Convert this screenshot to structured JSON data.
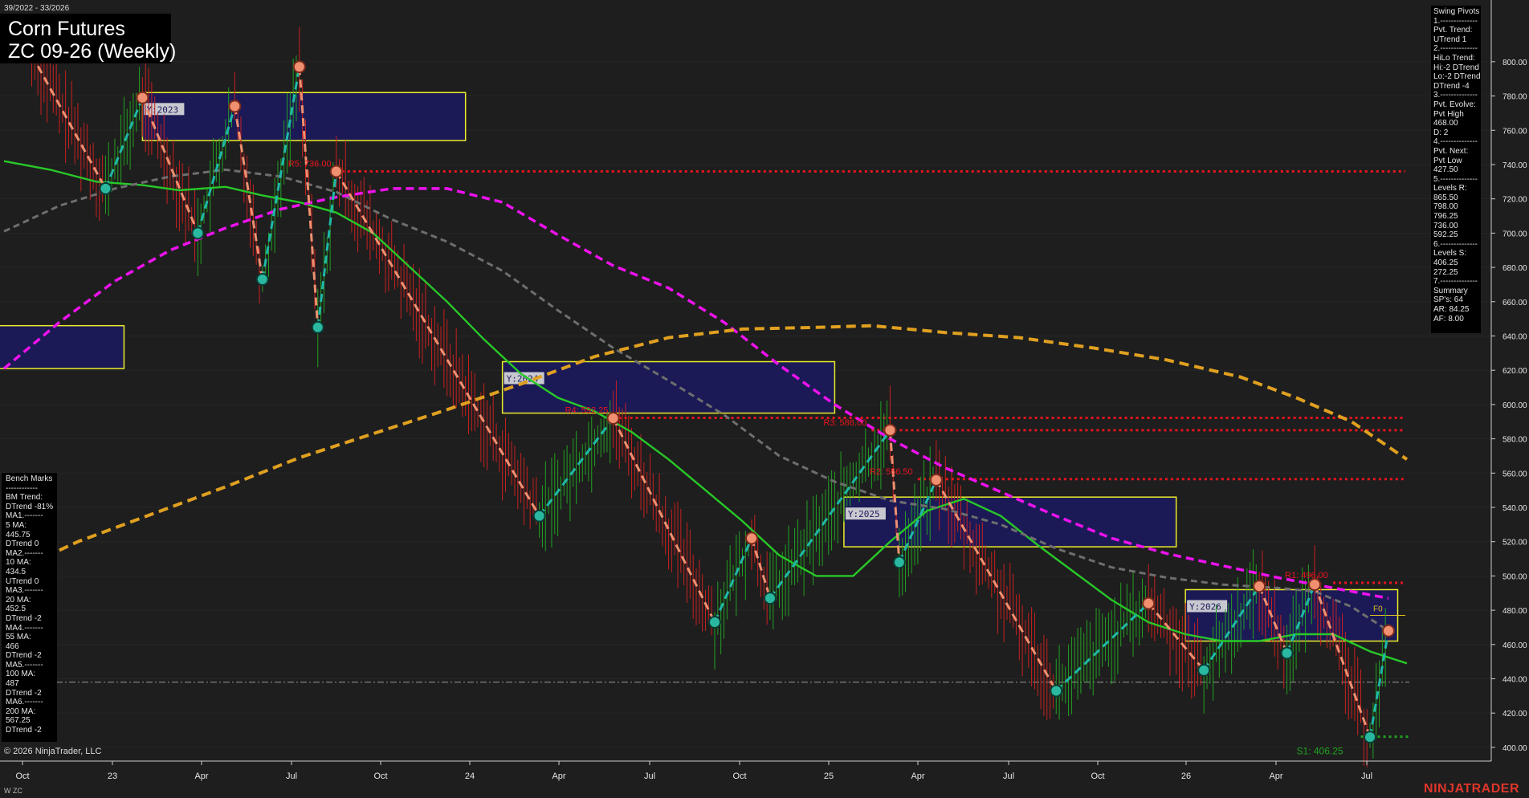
{
  "header": {
    "date_range": "39/2022 - 33/2026",
    "instrument": "Corn Futures",
    "contract": "ZC 09-26 (Weekly)",
    "copyright": "© 2026 NinjaTrader, LLC",
    "footer_tag": "W ZC",
    "brand": "NINJATRADER"
  },
  "bench_marks": {
    "lines": [
      "Bench Marks",
      "------------",
      "BM Trend:",
      "DTrend -81%",
      "MA1.-------",
      "5 MA:",
      "445.75",
      "DTrend 0",
      "MA2.-------",
      "10 MA:",
      "434.5",
      "UTrend 0",
      "MA3.-------",
      "20 MA:",
      "452.5",
      "DTrend -2",
      "MA4.-------",
      "55 MA:",
      "466",
      "DTrend -2",
      "MA5.-------",
      "100 MA:",
      "487",
      "DTrend -2",
      "MA6.-------",
      "200 MA:",
      "567.25",
      "DTrend -2"
    ]
  },
  "swing_pivots": {
    "lines": [
      "Swing Pivots",
      "1.--------------",
      "Pvt. Trend:",
      "UTrend 1",
      "2.--------------",
      "HiLo Trend:",
      "Hi:-2 DTrend",
      "Lo:-2 DTrend",
      "DTrend -4",
      "3.--------------",
      "Pvt. Evolve:",
      "Pvt High",
      "468.00",
      "D: 2",
      "4.--------------",
      "Pvt. Next:",
      "Pvt Low",
      "427.50",
      "5.--------------",
      "Levels R:",
      "865.50",
      "798.00",
      "796.25",
      "736.00",
      "592.25",
      "6.--------------",
      "Levels S:",
      "406.25",
      "272.25",
      "7.--------------",
      "Summary",
      "SP's: 64",
      "AR: 84.25",
      "AF: 8.00"
    ]
  },
  "chart_data": {
    "type": "line",
    "title": "ZC 09-26 (Weekly)",
    "x_labels": [
      "Oct",
      "23",
      "Apr",
      "Jul",
      "Oct",
      "24",
      "Apr",
      "Jul",
      "Oct",
      "25",
      "Apr",
      "Jul",
      "Oct",
      "26",
      "Apr",
      "Jul"
    ],
    "y_ticks": [
      "800.00",
      "780.00",
      "760.00",
      "740.00",
      "720.00",
      "700.00",
      "680.00",
      "660.00",
      "640.00",
      "620.00",
      "600.00",
      "580.00",
      "560.00",
      "540.00",
      "520.00",
      "500.00",
      "480.00",
      "460.00",
      "440.00",
      "420.00",
      "400.00"
    ],
    "y_tick_values": [
      800,
      780,
      760,
      740,
      720,
      700,
      680,
      660,
      640,
      620,
      600,
      580,
      560,
      540,
      520,
      500,
      480,
      460,
      440,
      420,
      400
    ],
    "ylim": [
      392,
      836
    ],
    "colors": {
      "background": "#1e1e1e",
      "grid": "#262626",
      "resistance": "#e8141e",
      "support": "#1fa31f",
      "up_swing": "#1fb8a8",
      "down_swing": "#ef9070",
      "ma_green": "#28c828",
      "ma_gray": "#6e6e6e",
      "ma_magenta": "#ee12ee",
      "ma_orange": "#e0a020",
      "year_box_fill": "#1b1a5c",
      "year_box_border": "#ecec2a"
    },
    "year_boxes": [
      {
        "label": "Y:2023",
        "week_start": 13,
        "week_end": 48,
        "high": 782,
        "low": 754
      },
      {
        "label": "",
        "week_start": -12,
        "week_end": 11,
        "high": 646,
        "low": 621
      },
      {
        "label": "Y:2024",
        "week_start": 52,
        "week_end": 88,
        "high": 625,
        "low": 595
      },
      {
        "label": "Y:2025",
        "week_start": 89,
        "week_end": 125,
        "high": 546,
        "low": 517
      },
      {
        "label": "Y:2026",
        "week_start": 126,
        "week_end": 149,
        "high": 492,
        "low": 462
      }
    ],
    "resistance_levels": [
      {
        "label": "R5: 736.00",
        "value": 736,
        "week_start": 34
      },
      {
        "label": "R4: 592.25",
        "value": 592.25,
        "week_start": 64
      },
      {
        "label": "R3: 586.00",
        "value": 585,
        "week_start": 92
      },
      {
        "label": "R2: 556.50",
        "value": 556.5,
        "week_start": 97
      },
      {
        "label": "R1: 496.00",
        "value": 496,
        "week_start": 142
      }
    ],
    "support_levels": [
      {
        "label": "S1: 406.25",
        "value": 406.25,
        "week_start": 145
      }
    ],
    "f0_label": "F0",
    "f0_value": 477,
    "reference_line": 438,
    "swing_pivots": [
      {
        "week": 1,
        "value": 804,
        "kind": "high"
      },
      {
        "week": 9,
        "value": 726,
        "kind": "low"
      },
      {
        "week": 13,
        "value": 779,
        "kind": "high"
      },
      {
        "week": 19,
        "value": 700,
        "kind": "low"
      },
      {
        "week": 23,
        "value": 774,
        "kind": "high"
      },
      {
        "week": 26,
        "value": 673,
        "kind": "low"
      },
      {
        "week": 30,
        "value": 797,
        "kind": "high"
      },
      {
        "week": 32,
        "value": 645,
        "kind": "low"
      },
      {
        "week": 34,
        "value": 736,
        "kind": "high"
      },
      {
        "week": 56,
        "value": 535,
        "kind": "low"
      },
      {
        "week": 64,
        "value": 592,
        "kind": "high"
      },
      {
        "week": 75,
        "value": 473,
        "kind": "low"
      },
      {
        "week": 79,
        "value": 522,
        "kind": "high"
      },
      {
        "week": 81,
        "value": 487,
        "kind": "low"
      },
      {
        "week": 94,
        "value": 585,
        "kind": "high"
      },
      {
        "week": 95,
        "value": 508,
        "kind": "low"
      },
      {
        "week": 99,
        "value": 556,
        "kind": "high"
      },
      {
        "week": 112,
        "value": 433,
        "kind": "low"
      },
      {
        "week": 122,
        "value": 484,
        "kind": "high"
      },
      {
        "week": 128,
        "value": 445,
        "kind": "low"
      },
      {
        "week": 134,
        "value": 494,
        "kind": "high"
      },
      {
        "week": 137,
        "value": 455,
        "kind": "low"
      },
      {
        "week": 140,
        "value": 495,
        "kind": "high"
      },
      {
        "week": 146,
        "value": 406,
        "kind": "low"
      },
      {
        "week": 148,
        "value": 468,
        "kind": "high"
      }
    ],
    "moving_averages": [
      {
        "color_key": "ma_green",
        "width": 2.4,
        "dash": "",
        "points": [
          [
            -2,
            742
          ],
          [
            3,
            737
          ],
          [
            8,
            730
          ],
          [
            13,
            728
          ],
          [
            17,
            725
          ],
          [
            22,
            727
          ],
          [
            26,
            722
          ],
          [
            30,
            718
          ],
          [
            34,
            712
          ],
          [
            38,
            700
          ],
          [
            42,
            680
          ],
          [
            46,
            660
          ],
          [
            50,
            638
          ],
          [
            54,
            618
          ],
          [
            58,
            604
          ],
          [
            62,
            596
          ],
          [
            66,
            584
          ],
          [
            70,
            568
          ],
          [
            74,
            550
          ],
          [
            78,
            532
          ],
          [
            82,
            512
          ],
          [
            86,
            500
          ],
          [
            90,
            500
          ],
          [
            94,
            520
          ],
          [
            98,
            538
          ],
          [
            102,
            545
          ],
          [
            106,
            535
          ],
          [
            110,
            518
          ],
          [
            114,
            502
          ],
          [
            118,
            486
          ],
          [
            122,
            473
          ],
          [
            126,
            466
          ],
          [
            130,
            462
          ],
          [
            134,
            462
          ],
          [
            138,
            466
          ],
          [
            142,
            466
          ],
          [
            146,
            456
          ],
          [
            150,
            449
          ]
        ]
      },
      {
        "color_key": "ma_gray",
        "width": 3,
        "dash": "8 5",
        "points": [
          [
            -2,
            701
          ],
          [
            4,
            716
          ],
          [
            10,
            726
          ],
          [
            16,
            733
          ],
          [
            22,
            737
          ],
          [
            28,
            733
          ],
          [
            34,
            724
          ],
          [
            40,
            708
          ],
          [
            46,
            695
          ],
          [
            52,
            678
          ],
          [
            58,
            655
          ],
          [
            64,
            633
          ],
          [
            70,
            614
          ],
          [
            76,
            594
          ],
          [
            82,
            570
          ],
          [
            88,
            555
          ],
          [
            94,
            544
          ],
          [
            100,
            539
          ],
          [
            106,
            530
          ],
          [
            112,
            516
          ],
          [
            118,
            505
          ],
          [
            124,
            499
          ],
          [
            130,
            495
          ],
          [
            136,
            493
          ],
          [
            140,
            491
          ],
          [
            144,
            482
          ],
          [
            148,
            468
          ]
        ]
      },
      {
        "color_key": "ma_magenta",
        "width": 3.5,
        "dash": "10 6",
        "points": [
          [
            -2,
            621
          ],
          [
            4,
            648
          ],
          [
            10,
            672
          ],
          [
            16,
            690
          ],
          [
            22,
            703
          ],
          [
            28,
            714
          ],
          [
            34,
            721
          ],
          [
            40,
            726
          ],
          [
            46,
            726
          ],
          [
            52,
            718
          ],
          [
            58,
            699
          ],
          [
            64,
            681
          ],
          [
            70,
            668
          ],
          [
            76,
            648
          ],
          [
            82,
            623
          ],
          [
            88,
            600
          ],
          [
            94,
            580
          ],
          [
            100,
            563
          ],
          [
            106,
            549
          ],
          [
            112,
            535
          ],
          [
            118,
            522
          ],
          [
            124,
            513
          ],
          [
            130,
            506
          ],
          [
            136,
            499
          ],
          [
            142,
            493
          ],
          [
            148,
            487
          ]
        ]
      },
      {
        "color_key": "ma_orange",
        "width": 4,
        "dash": "12 7",
        "points": [
          [
            -2,
            500
          ],
          [
            6,
            520
          ],
          [
            14,
            536
          ],
          [
            22,
            552
          ],
          [
            30,
            569
          ],
          [
            38,
            583
          ],
          [
            46,
            597
          ],
          [
            54,
            612
          ],
          [
            62,
            628
          ],
          [
            70,
            639
          ],
          [
            78,
            644
          ],
          [
            86,
            645
          ],
          [
            92,
            646
          ],
          [
            100,
            642
          ],
          [
            108,
            639
          ],
          [
            116,
            633
          ],
          [
            124,
            626
          ],
          [
            132,
            616
          ],
          [
            138,
            604
          ],
          [
            144,
            590
          ],
          [
            150,
            568
          ]
        ]
      }
    ]
  }
}
